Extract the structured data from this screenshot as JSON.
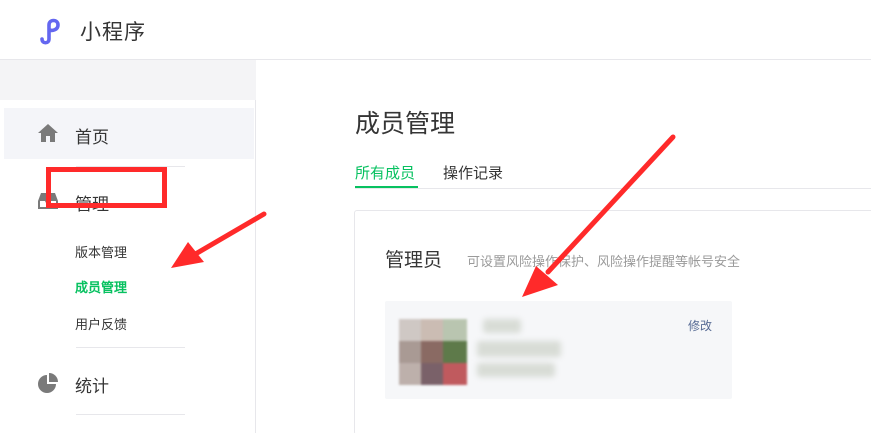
{
  "app": {
    "title": "小程序",
    "logo_icon": "miniprogram-logo-icon",
    "brand_color": "#07c160"
  },
  "sidebar": {
    "home": {
      "label": "首页",
      "icon": "home-icon"
    },
    "manage": {
      "label": "管理",
      "icon": "inbox-icon",
      "items": [
        {
          "label": "版本管理",
          "active": false
        },
        {
          "label": "成员管理",
          "active": true
        },
        {
          "label": "用户反馈",
          "active": false
        }
      ]
    },
    "stats": {
      "label": "统计",
      "icon": "pie-chart-icon"
    }
  },
  "main": {
    "title": "成员管理",
    "tabs": [
      {
        "label": "所有成员",
        "active": true
      },
      {
        "label": "操作记录",
        "active": false
      }
    ],
    "admin_card": {
      "title": "管理员",
      "description": "可设置风险操作保护、风险操作提醒等帐号安全",
      "edit_label": "修改"
    }
  },
  "annotation_color": "#ff2a2a"
}
